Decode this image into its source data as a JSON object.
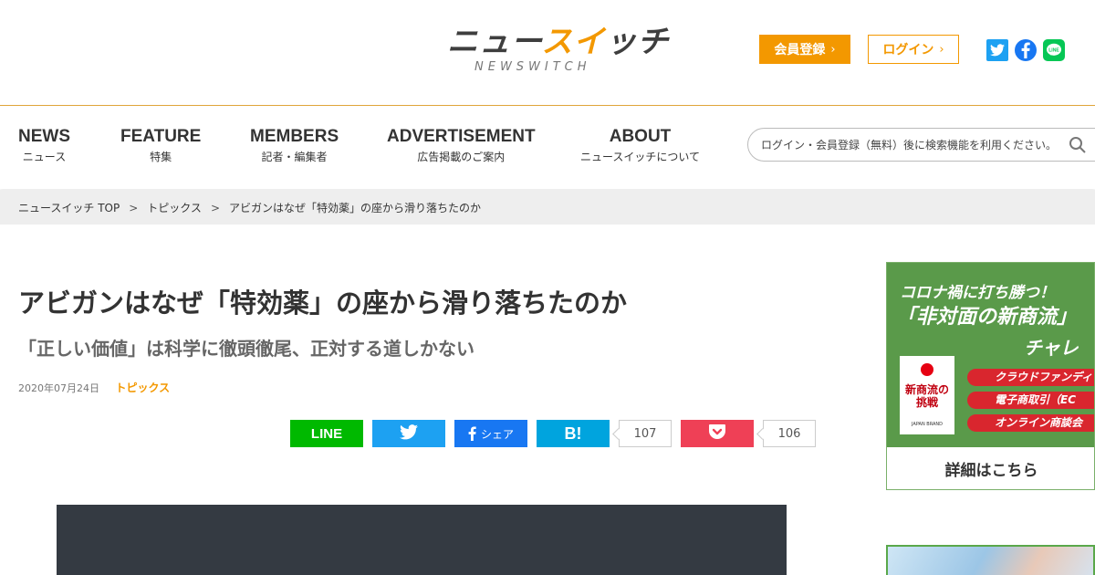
{
  "header": {
    "logo_main_a": "ニュー",
    "logo_main_b": "スイ",
    "logo_main_c": "ッチ",
    "logo_sub": "NEWSWITCH",
    "register_label": "会員登録",
    "login_label": "ログイン",
    "social_icons": [
      "twitter-icon",
      "facebook-icon",
      "line-icon"
    ]
  },
  "nav": {
    "items": [
      {
        "en": "NEWS",
        "ja": "ニュース"
      },
      {
        "en": "FEATURE",
        "ja": "特集"
      },
      {
        "en": "MEMBERS",
        "ja": "記者・編集者"
      },
      {
        "en": "ADVERTISEMENT",
        "ja": "広告掲載のご案内"
      },
      {
        "en": "ABOUT",
        "ja": "ニュースイッチについて"
      }
    ],
    "search_placeholder": "ログイン・会員登録（無料）後に検索機能を利用ください。"
  },
  "breadcrumb": {
    "items": [
      "ニュースイッチ TOP",
      "トピックス",
      "アビガンはなぜ「特効薬」の座から滑り落ちたのか"
    ],
    "separator": ">"
  },
  "article": {
    "title": "アビガンはなぜ「特効薬」の座から滑り落ちたのか",
    "subtitle": "「正しい価値」は科学に徹頭徹尾、正対する道しかない",
    "date": "2020年07月24日",
    "category": "トピックス"
  },
  "share": {
    "line_label": "LINE",
    "facebook_label": "シェア",
    "hatena_label": "B!",
    "hatena_count": "107",
    "pocket_count": "106"
  },
  "sidebar_ad": {
    "headline1": "コロナ禍に打ち勝つ！",
    "headline2": "「非対面の新商流」",
    "headline3": "チャレ",
    "logo_text": "新商流の挑戦",
    "logo_brand": "JAPAN BRAND",
    "pills": [
      "クラウドファンディ",
      "電子商取引（EC",
      "オンライン商談会"
    ],
    "cta": "詳細はこちら"
  },
  "colors": {
    "accent": "#f39800",
    "line": "#00b900",
    "twitter": "#1da1f2",
    "facebook": "#1877f2",
    "hatena": "#00a4de",
    "pocket": "#ef4056"
  }
}
